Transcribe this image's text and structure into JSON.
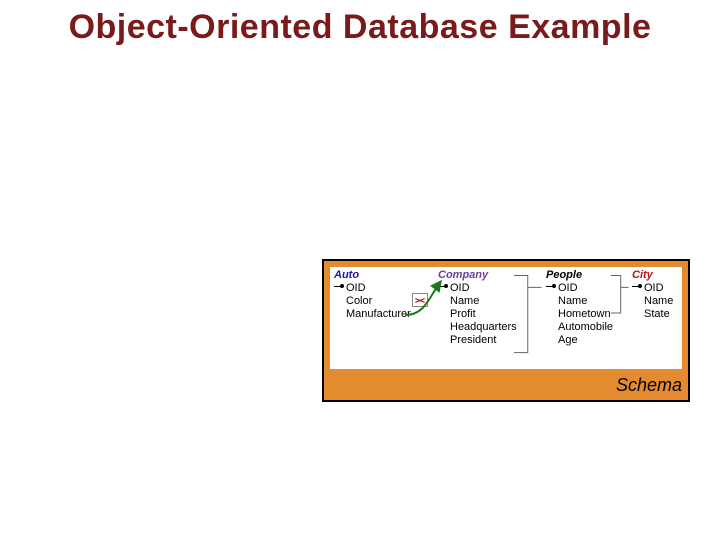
{
  "title": "Object-Oriented Database Example",
  "schema": {
    "label": "Schema",
    "entities": {
      "auto": {
        "name": "Auto",
        "attrs": [
          "OID",
          "Color",
          "Manufacturer"
        ]
      },
      "company": {
        "name": "Company",
        "attrs": [
          "OID",
          "Name",
          "Profit",
          "Headquarters",
          "President"
        ]
      },
      "people": {
        "name": "People",
        "attrs": [
          "OID",
          "Name",
          "Hometown",
          "Automobile",
          "Age"
        ]
      },
      "city": {
        "name": "City",
        "attrs": [
          "OID",
          "Name",
          "State"
        ]
      }
    },
    "relations": [
      {
        "from": "Auto.Manufacturer",
        "to": "Company"
      },
      {
        "from": "Company.Headquarters",
        "to": "City"
      },
      {
        "from": "Company.President",
        "to": "People"
      },
      {
        "from": "People.Hometown",
        "to": "City"
      },
      {
        "from": "People.Automobile",
        "to": "Auto"
      }
    ]
  }
}
